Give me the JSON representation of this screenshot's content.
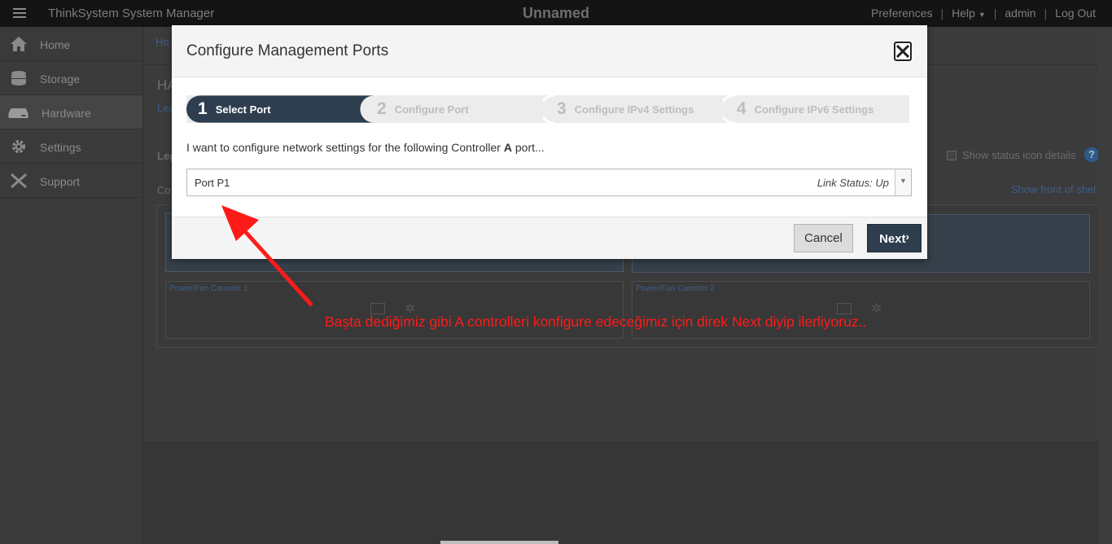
{
  "topbar": {
    "app_title": "ThinkSystem System Manager",
    "center_title": "Unnamed",
    "nav": {
      "preferences": "Preferences",
      "help": "Help",
      "user": "admin",
      "logout": "Log Out"
    }
  },
  "sidebar": {
    "items": [
      {
        "label": "Home",
        "icon": "home-icon"
      },
      {
        "label": "Storage",
        "icon": "storage-icon"
      },
      {
        "label": "Hardware",
        "icon": "hardware-icon"
      },
      {
        "label": "Settings",
        "icon": "gear-icon"
      },
      {
        "label": "Support",
        "icon": "tools-icon"
      }
    ],
    "active": "Hardware"
  },
  "background": {
    "breadcrumb": "Ho",
    "page_heading": "HA",
    "learn_link": "Lea",
    "legend": "Leg",
    "controller_label": "Co",
    "show_status_icon_details": "Show status icon details",
    "show_front_of_shelf": "Show front of shel",
    "canister_1": "Power/Fan Canister 1",
    "canister_2": "Power/Fan Canister 2"
  },
  "modal": {
    "title": "Configure Management Ports",
    "steps": [
      {
        "num": "1",
        "label": "Select Port"
      },
      {
        "num": "2",
        "label": "Configure Port"
      },
      {
        "num": "3",
        "label": "Configure IPv4 Settings"
      },
      {
        "num": "4",
        "label": "Configure IPv6 Settings"
      }
    ],
    "active_step": 1,
    "prompt_before": "I want to configure network settings for the following Controller ",
    "prompt_controller": "A",
    "prompt_after": " port...",
    "port_select": {
      "value": "Port P1",
      "status": "Link Status: Up"
    },
    "cancel_label": "Cancel",
    "next_label": "Next"
  },
  "annotation": {
    "text": "Başta dediğimiz gibi A controlleri konfigure edeceğimiz için direk Next diyip ilerliyoruz..",
    "color": "#ff1a1a"
  },
  "colors": {
    "active_step": "#2e3e4f",
    "next_button": "#2e3e4f"
  }
}
